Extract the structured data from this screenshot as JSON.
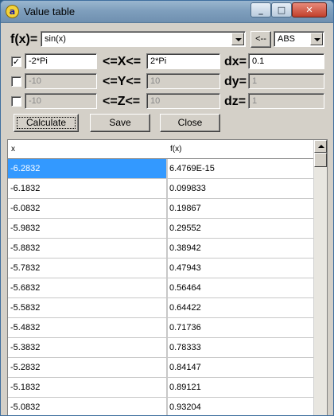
{
  "window": {
    "title": "Value table",
    "app_icon_glyph": "a"
  },
  "function_row": {
    "label": "f(x)=",
    "expression": "sin(x)",
    "insert_button": "<--",
    "function_select": "ABS"
  },
  "x_row": {
    "checked": true,
    "from": "-2*Pi",
    "range_label": "<=X<=",
    "to": "2*Pi",
    "step_label": "dx=",
    "step": "0.1"
  },
  "y_row": {
    "checked": false,
    "from": "-10",
    "range_label": "<=Y<=",
    "to": "10",
    "step_label": "dy=",
    "step": "1"
  },
  "z_row": {
    "checked": false,
    "from": "-10",
    "range_label": "<=Z<=",
    "to": "10",
    "step_label": "dz=",
    "step": "1"
  },
  "buttons": {
    "calculate": "Calculate",
    "save": "Save",
    "close": "Close"
  },
  "table": {
    "columns": [
      "x",
      "f(x)"
    ],
    "rows": [
      [
        "-6.2832",
        "6.4769E-15"
      ],
      [
        "-6.1832",
        "0.099833"
      ],
      [
        "-6.0832",
        "0.19867"
      ],
      [
        "-5.9832",
        "0.29552"
      ],
      [
        "-5.8832",
        "0.38942"
      ],
      [
        "-5.7832",
        "0.47943"
      ],
      [
        "-5.6832",
        "0.56464"
      ],
      [
        "-5.5832",
        "0.64422"
      ],
      [
        "-5.4832",
        "0.71736"
      ],
      [
        "-5.3832",
        "0.78333"
      ],
      [
        "-5.2832",
        "0.84147"
      ],
      [
        "-5.1832",
        "0.89121"
      ],
      [
        "-5.0832",
        "0.93204"
      ]
    ],
    "selected_row": 0
  },
  "colors": {
    "selection": "#3399ff",
    "face": "#d4d0c8"
  }
}
